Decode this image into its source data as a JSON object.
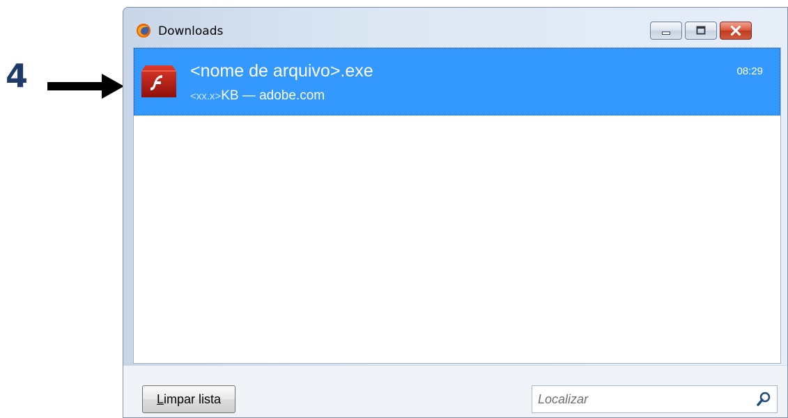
{
  "annotation": {
    "step_number": "4"
  },
  "window": {
    "title": "Downloads",
    "app_icon": "firefox-icon",
    "controls": {
      "minimize": "minimize-icon",
      "maximize": "maximize-icon",
      "close": "close-icon"
    }
  },
  "downloads": [
    {
      "icon": "flash-icon",
      "name": "<nome de arquivo>.exe",
      "size": "<xx.x>",
      "size_unit": "KB — adobe.com",
      "time": "08:29"
    }
  ],
  "footer": {
    "clear_label_first": "L",
    "clear_label_rest": "impar lista",
    "search_placeholder": "Localizar",
    "search_icon": "search-icon"
  },
  "colors": {
    "selection": "#3399ff",
    "annotation_text": "#1f3a68",
    "close_button": "#c0391c"
  }
}
